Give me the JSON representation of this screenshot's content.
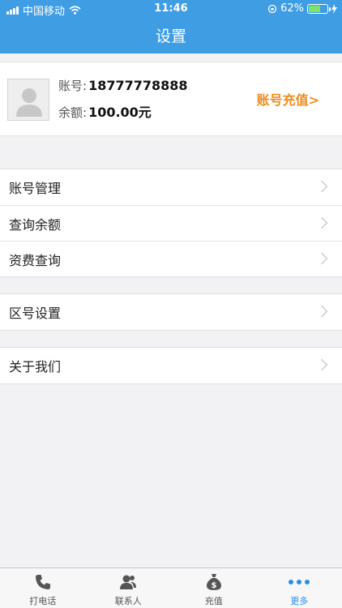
{
  "status_bar": {
    "carrier": "中国移动",
    "time": "11:46",
    "battery": "62%",
    "battery_level": 0.62
  },
  "nav": {
    "title": "设置"
  },
  "account": {
    "account_label": "账号:",
    "account_value": "18777778888",
    "balance_label": "余额:",
    "balance_value": "100.00元",
    "recharge_link": "账号充值>"
  },
  "menu": {
    "group1": [
      {
        "label": "账号管理"
      },
      {
        "label": "查询余额"
      },
      {
        "label": "资费查询"
      }
    ],
    "group2": [
      {
        "label": "区号设置"
      }
    ],
    "group3": [
      {
        "label": "关于我们"
      }
    ]
  },
  "tabbar": {
    "tabs": [
      {
        "label": "打电话",
        "icon": "phone-icon"
      },
      {
        "label": "联系人",
        "icon": "contacts-icon"
      },
      {
        "label": "充值",
        "icon": "money-bag-icon"
      },
      {
        "label": "更多",
        "icon": "more-dots-icon"
      }
    ],
    "active_index": 3,
    "active_color": "#2a8ee6"
  },
  "colors": {
    "header": "#3f9de4",
    "recharge": "#ef8c1e",
    "background": "#f2f2f4"
  }
}
